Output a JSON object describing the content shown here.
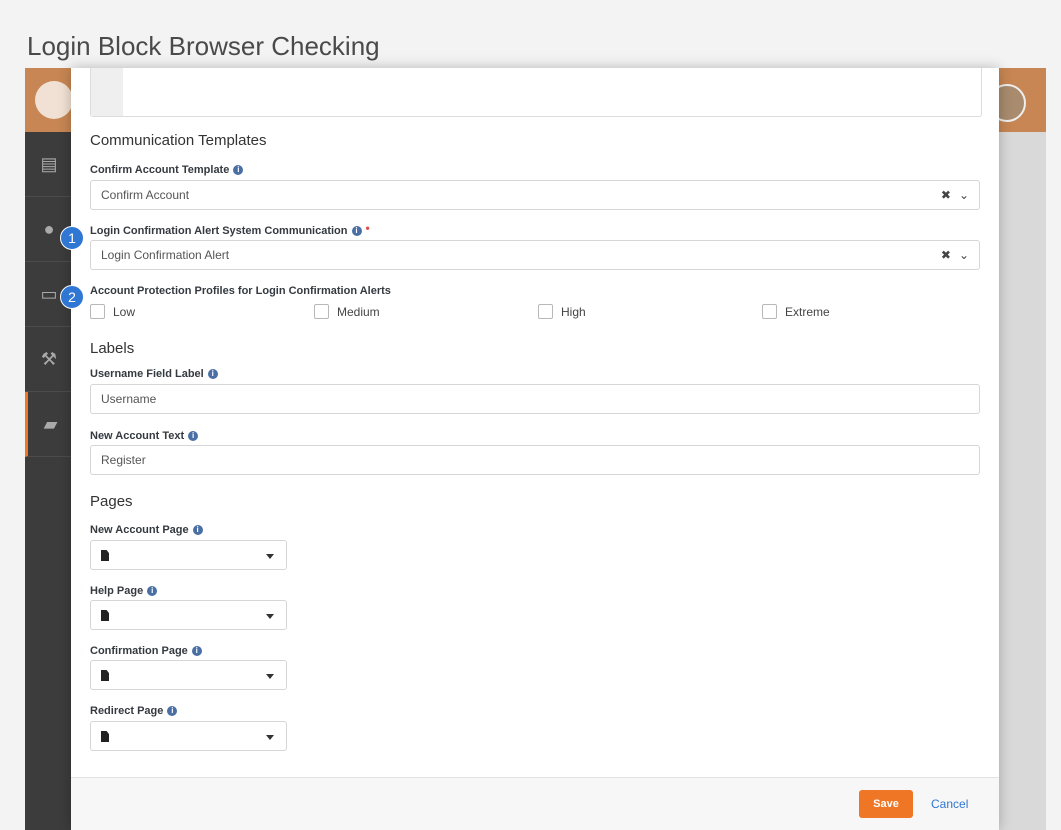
{
  "page_title": "Login Block Browser Checking",
  "communication": {
    "section_title": "Communication Templates",
    "confirm_label": "Confirm Account Template",
    "confirm_value": "Confirm Account",
    "alert_label": "Login Confirmation Alert System Communication",
    "alert_value": "Login Confirmation Alert",
    "profiles_label": "Account Protection Profiles for Login Confirmation Alerts",
    "profiles": [
      "Low",
      "Medium",
      "High",
      "Extreme"
    ]
  },
  "labels": {
    "section_title": "Labels",
    "username_label": "Username Field Label",
    "username_value": "Username",
    "new_account_label": "New Account Text",
    "new_account_value": "Register"
  },
  "pages": {
    "section_title": "Pages",
    "items": [
      "New Account Page",
      "Help Page",
      "Confirmation Page",
      "Redirect Page"
    ]
  },
  "markers": [
    "1",
    "2"
  ],
  "footer": {
    "save_label": "Save",
    "cancel_label": "Cancel"
  },
  "glyphs": {
    "info": "i",
    "required": "•",
    "clear": "✖",
    "chevron": "⌄"
  },
  "colors": {
    "accent": "#ee7625",
    "link": "#2f77d3",
    "header": "#c78653"
  }
}
